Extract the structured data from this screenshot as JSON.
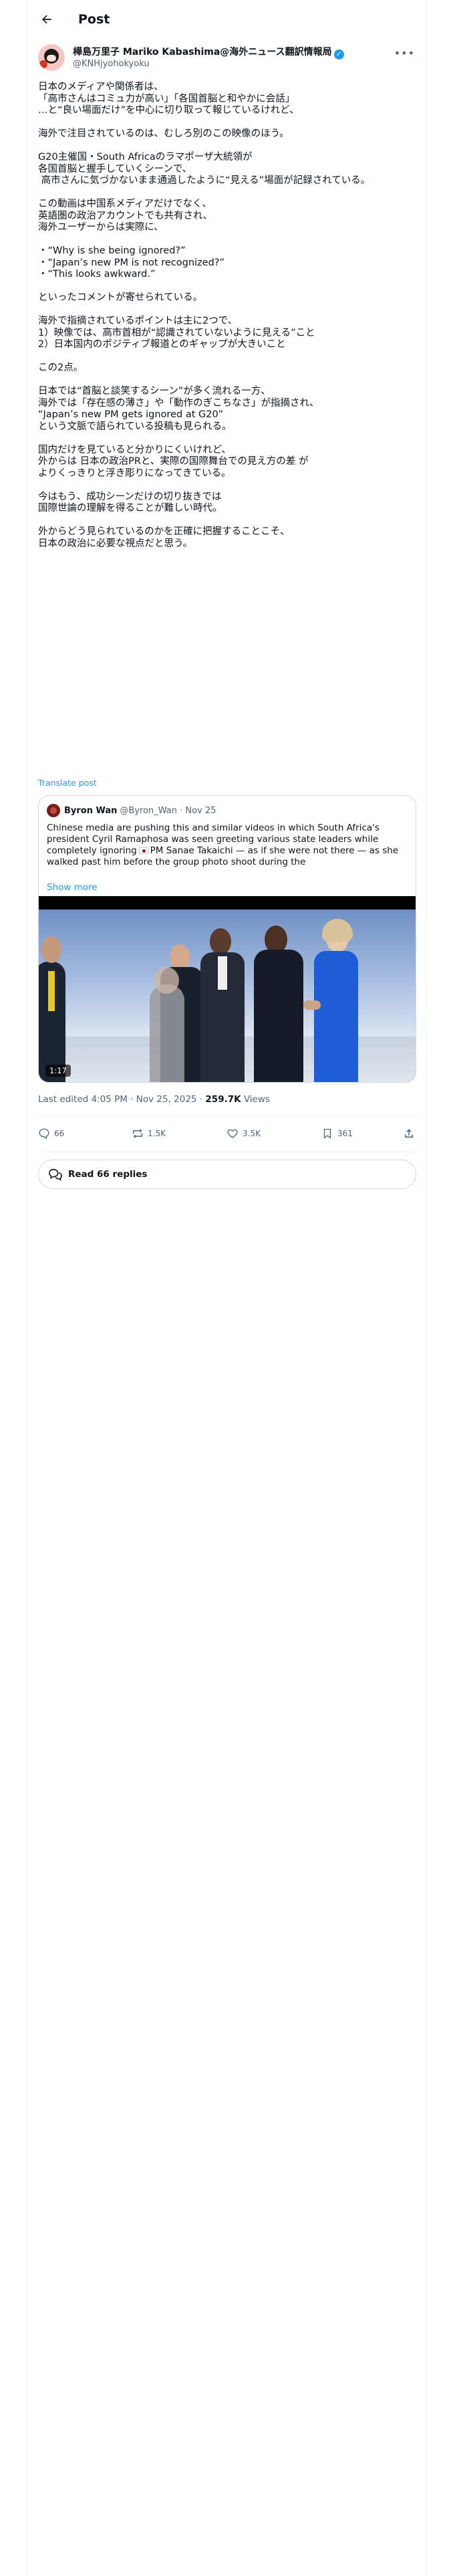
{
  "header": {
    "title": "Post"
  },
  "author": {
    "display_name": "樺島万里子 Mariko Kabashima@海外ニュース翻訳情報局",
    "handle": "@KNHjyohokyoku",
    "verified_glyph": "✓"
  },
  "tweet": {
    "text": "日本のメディアや関係者は、\n「高市さんはコミュ力が高い」「各国首脳と和やかに会話」\n…と“良い場面だけ”を中心に切り取って報じているけれど、\n\n海外で注目されているのは、むしろ別のこの映像のほう。\n\nG20主催国・South Africaのラマポーザ大統領が\n各国首脳と握手していくシーンで、\n 高市さんに気づかないまま通過したように“見える”場面が記録されている。\n\nこの動画は中国系メディアだけでなく、\n英語圏の政治アカウントでも共有され、\n海外ユーザーからは実際に、\n\n・“Why is she being ignored?”\n・“Japan’s new PM is not recognized?”\n・“This looks awkward.”\n\nといったコメントが寄せられている。\n\n海外で指摘されているポイントは主に2つで、\n1）映像では、高市首相が“認識されていないように見える”こと\n2）日本国内のポジティブ報道とのギャップが大きいこと\n\nこの2点。\n\n日本では“首脳と談笑するシーン”が多く流れる一方、\n海外では「存在感の薄さ」や「動作のぎこちなさ」が指摘され、\n“Japan’s new PM gets ignored at G20”\nという文脈で語られている投稿も見られる。\n\n国内だけを見ていると分かりにくいけれど、\n外からは 日本の政治PRと、実際の国際舞台での見え方の差 が\nよりくっきりと浮き彫りになってきている。\n\n今はもう、成功シーンだけの切り抜きでは\n国際世論の理解を得ることが難しい時代。\n\n外からどう見られているのかを正確に把握することこそ、\n日本の政治に必要な視点だと思う。",
    "translate_label": "Translate post"
  },
  "quote": {
    "name": "Byron Wan",
    "meta": "@Byron_Wan · Nov 25",
    "text_before_flag": "Chinese media are pushing this and similar videos in which South Africa's president Cyril Ramaphosa was seen greeting various state leaders while completely ignoring",
    "text_after_flag": "PM Sanae Takaichi — as if she were not there — as she walked past him before the group photo shoot during the",
    "show_more": "Show more",
    "video_time": "1:17"
  },
  "post_meta": {
    "edited": "Last edited 4:05 PM · Nov 25, 2025 · ",
    "views_count": "259.7K",
    "views_label": " Views"
  },
  "actions": {
    "replies": "66",
    "reposts": "1.5K",
    "likes": "3.5K",
    "bookmarks": "361"
  },
  "read_replies": "Read 66 replies",
  "colors": {
    "accent": "#1d9bf0",
    "text": "#0f1419",
    "muted": "#536471",
    "border": "#cfd9de"
  }
}
